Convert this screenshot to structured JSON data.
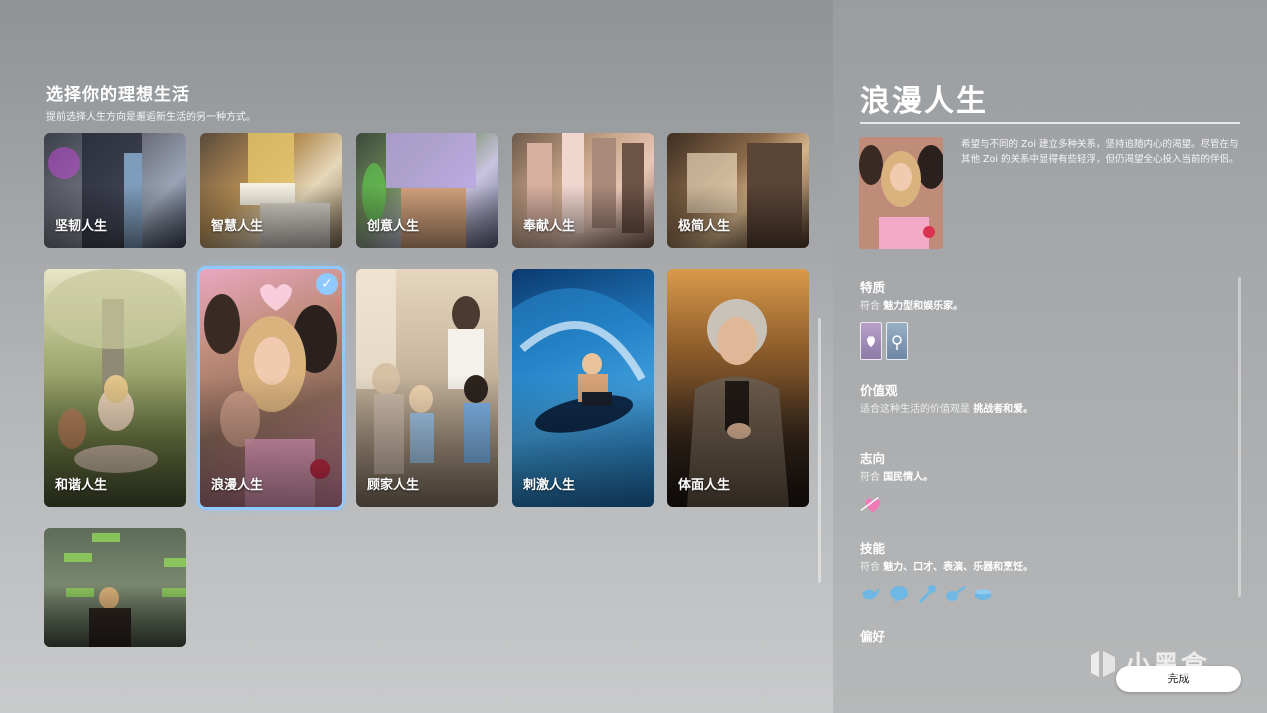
{
  "left": {
    "title": "选择你的理想生活",
    "subtitle": "提前选择人生方向是邂逅新生活的另一种方式。",
    "cards": [
      {
        "label": "坚韧人生",
        "selected": false
      },
      {
        "label": "智慧人生",
        "selected": false
      },
      {
        "label": "创意人生",
        "selected": false
      },
      {
        "label": "奉献人生",
        "selected": false
      },
      {
        "label": "极简人生",
        "selected": false
      },
      {
        "label": "和谐人生",
        "selected": false
      },
      {
        "label": "浪漫人生",
        "selected": true
      },
      {
        "label": "顾家人生",
        "selected": false
      },
      {
        "label": "刺激人生",
        "selected": false
      },
      {
        "label": "体面人生",
        "selected": false
      },
      {
        "label": "",
        "selected": false
      }
    ],
    "check_glyph": "✓"
  },
  "detail": {
    "title": "浪漫人生",
    "description": "希望与不同的 Zoi 建立多种关系，坚持追随内心的渴望。尽管在与其他 Zoi 的关系中显得有些轻浮，但仍渴望全心投入当前的伴侣。",
    "sections": {
      "traits": {
        "heading": "特质",
        "prefix": "符合",
        "value": "魅力型和娱乐家。"
      },
      "values": {
        "heading": "价值观",
        "prefix": "适合这种生活的价值观是",
        "value": "挑战者和爱。"
      },
      "aspiration": {
        "heading": "志向",
        "prefix": "符合",
        "value": "国民情人。"
      },
      "skills": {
        "heading": "技能",
        "prefix": "符合",
        "value": "魅力、口才、表演、乐器和烹饪。"
      },
      "preferences": {
        "heading": "偏好"
      }
    },
    "skill_icons": [
      "bird-icon",
      "speech-bubble-icon",
      "microphone-icon",
      "guitar-icon",
      "cooking-pot-icon"
    ],
    "aspiration_icon": "heart-arrow-icon"
  },
  "buttons": {
    "done": "完成"
  },
  "watermark": {
    "text": "小黑盒"
  },
  "colors": {
    "accent": "#8ec9ff",
    "skill_icon": "#6fb8e6",
    "heart": "#f07ab8"
  }
}
